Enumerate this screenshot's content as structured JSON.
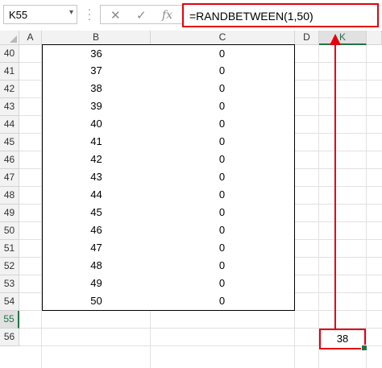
{
  "formula_bar": {
    "name_box": "K55",
    "formula": "=RANDBETWEEN(1,50)",
    "icons": [
      "cancel-icon",
      "enter-icon",
      "fx-icon"
    ]
  },
  "columns": [
    "A",
    "B",
    "C",
    "D",
    "K"
  ],
  "selected_column": "K",
  "rows": [
    "40",
    "41",
    "42",
    "43",
    "44",
    "45",
    "46",
    "47",
    "48",
    "49",
    "50",
    "51",
    "52",
    "53",
    "54",
    "55",
    "56"
  ],
  "selected_row": "55",
  "table": {
    "b_values": [
      "36",
      "37",
      "38",
      "39",
      "40",
      "41",
      "42",
      "43",
      "44",
      "45",
      "46",
      "47",
      "48",
      "49",
      "50"
    ],
    "c_values": [
      "0",
      "0",
      "0",
      "0",
      "0",
      "0",
      "0",
      "0",
      "0",
      "0",
      "0",
      "0",
      "0",
      "0",
      "0"
    ]
  },
  "k55_value": "38",
  "highlight_color": "#e3000f",
  "excel_green": "#217346"
}
